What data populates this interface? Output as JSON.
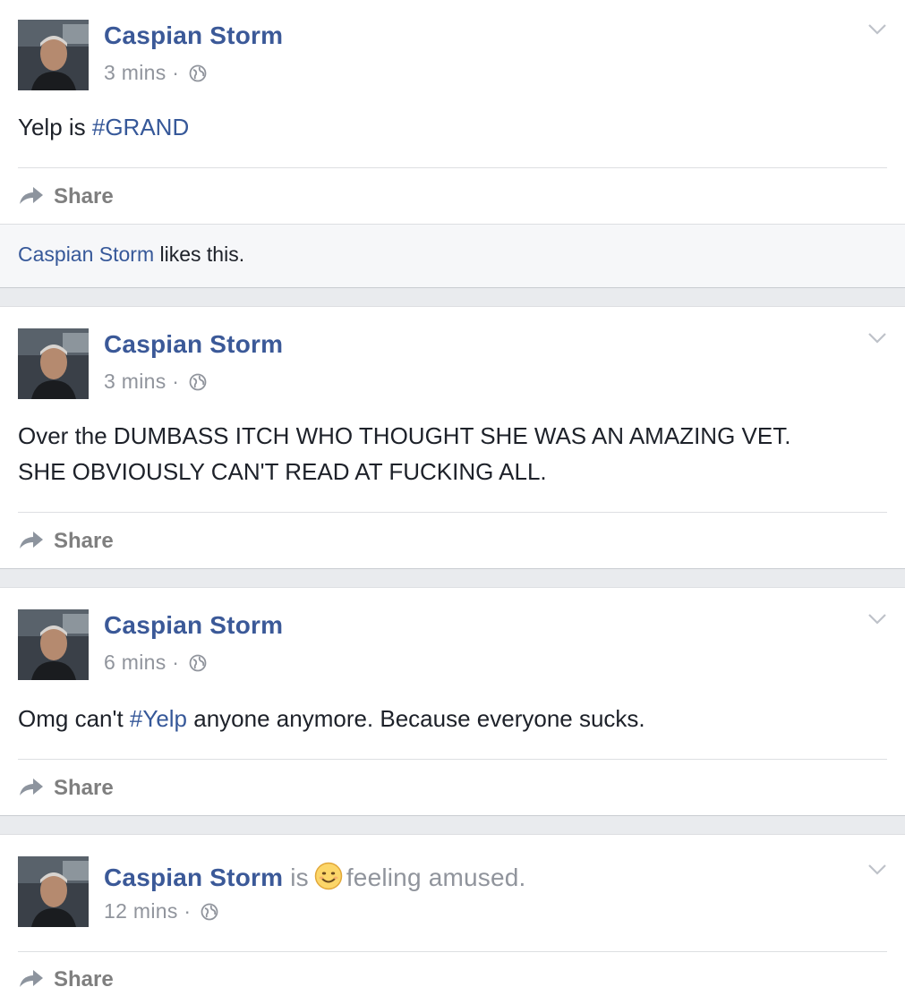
{
  "posts": [
    {
      "author": "Caspian Storm",
      "time": "3 mins",
      "separator": "·",
      "text_plain_before": "Yelp is ",
      "hashtag": "#GRAND",
      "text_plain_after": "",
      "share_label": "Share",
      "likes": {
        "name": "Caspian Storm",
        "text": "likes this."
      }
    },
    {
      "author": "Caspian Storm",
      "time": "3 mins",
      "separator": "·",
      "text_line1": "Over the DUMBASS ITCH WHO THOUGHT SHE WAS AN AMAZING VET.",
      "text_line2": "SHE OBVIOUSLY CAN'T READ AT FUCKING ALL.",
      "share_label": "Share"
    },
    {
      "author": "Caspian Storm",
      "time": "6 mins",
      "separator": "·",
      "text_plain_before": "Omg can't ",
      "hashtag": "#Yelp",
      "text_plain_after": " anyone anymore. Because everyone sucks.",
      "share_label": "Share"
    },
    {
      "author": "Caspian Storm",
      "is_word": "is",
      "feeling": "feeling amused.",
      "feeling_icon": "smiling-face-icon",
      "time": "12 mins",
      "separator": "·",
      "share_label": "Share"
    }
  ],
  "colors": {
    "link": "#365899",
    "name": "#3b5998",
    "meta": "#90949c",
    "background": "#e9ebee"
  },
  "icons": [
    "globe-icon",
    "chevron-down-icon",
    "share-arrow-icon",
    "smiling-face-icon"
  ]
}
